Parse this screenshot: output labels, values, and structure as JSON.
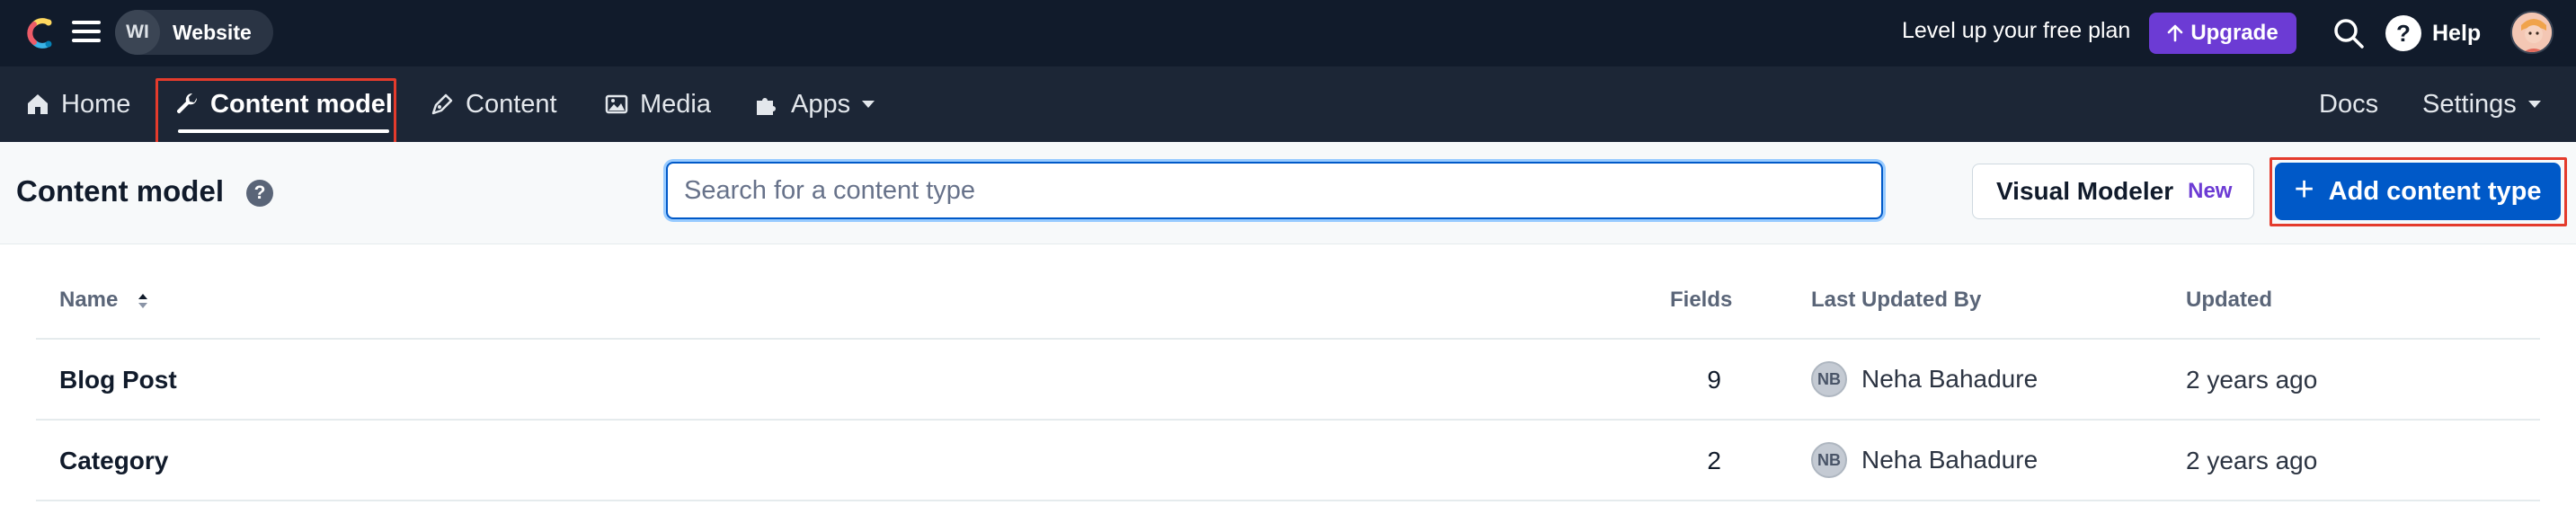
{
  "topbar": {
    "space_initials": "WI",
    "space_name": "Website",
    "promo_text": "Level up your free plan",
    "upgrade_label": "Upgrade",
    "help_label": "Help"
  },
  "nav": {
    "items": [
      {
        "label": "Home",
        "icon": "home-icon"
      },
      {
        "label": "Content model",
        "icon": "wrench-icon",
        "active": true
      },
      {
        "label": "Content",
        "icon": "pen-icon"
      },
      {
        "label": "Media",
        "icon": "image-icon"
      },
      {
        "label": "Apps",
        "icon": "puzzle-icon"
      }
    ],
    "docs_label": "Docs",
    "settings_label": "Settings"
  },
  "header": {
    "title": "Content model",
    "search_placeholder": "Search for a content type",
    "visual_modeler_label": "Visual Modeler",
    "visual_modeler_badge": "New",
    "add_button_label": "Add content type"
  },
  "table": {
    "columns": {
      "name": "Name",
      "fields": "Fields",
      "last_updated_by": "Last Updated By",
      "updated": "Updated"
    },
    "rows": [
      {
        "name": "Blog Post",
        "fields": "9",
        "user_initials": "NB",
        "user_name": "Neha Bahadure",
        "updated": "2 years ago"
      },
      {
        "name": "Category",
        "fields": "2",
        "user_initials": "NB",
        "user_name": "Neha Bahadure",
        "updated": "2 years ago"
      }
    ]
  },
  "colors": {
    "topbar_bg": "#111b2b",
    "navbar_bg": "#1c2636",
    "primary": "#0059c8",
    "upgrade": "#6c3bd4",
    "highlight": "#e43b2c"
  }
}
